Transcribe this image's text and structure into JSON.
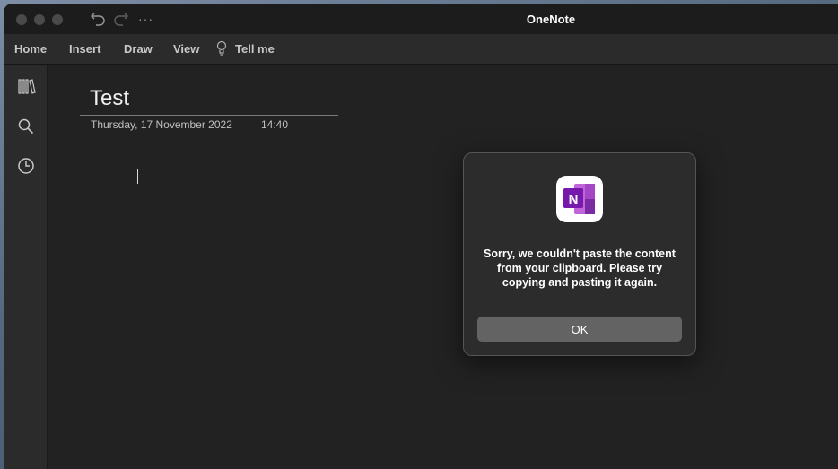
{
  "window": {
    "title": "OneNote"
  },
  "titlebar": {
    "icons": [
      "close-icon",
      "minimize-icon",
      "zoom-icon",
      "undo-icon",
      "redo-icon",
      "more-icon"
    ],
    "more_glyph": "···"
  },
  "ribbon": {
    "tabs": [
      {
        "label": "Home"
      },
      {
        "label": "Insert"
      },
      {
        "label": "Draw"
      },
      {
        "label": "View"
      }
    ],
    "tell_me": "Tell me"
  },
  "sidebar": {
    "icons": [
      "notebooks-icon",
      "search-icon",
      "recent-icon"
    ]
  },
  "page": {
    "title": "Test",
    "date": "Thursday, 17 November 2022",
    "time": "14:40"
  },
  "dialog": {
    "message": "Sorry, we couldn't paste the content from your clipboard. Please try copying and pasting it again.",
    "ok_label": "OK",
    "icon": "onenote-app-icon",
    "icon_letter": "N"
  },
  "colors": {
    "background": "#222222",
    "ribbon": "#2b2b2b",
    "onenote_purple": "#7719aa",
    "button": "#636363"
  }
}
